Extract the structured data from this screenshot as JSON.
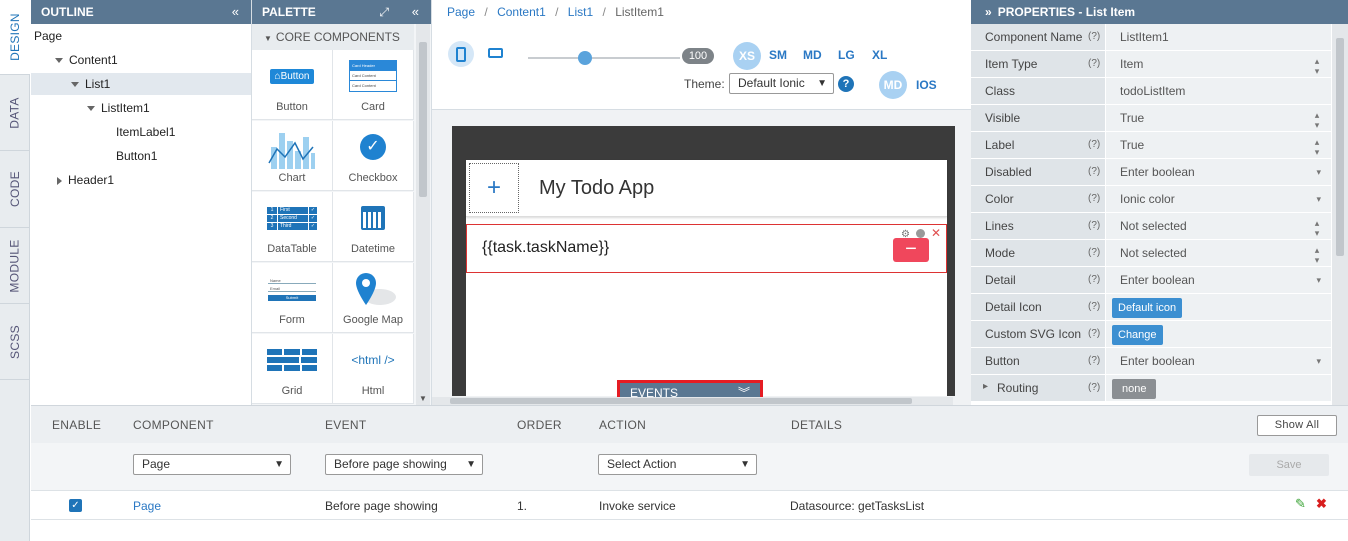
{
  "vertical_tabs": [
    {
      "label": "DESIGN",
      "active": true
    },
    {
      "label": "DATA",
      "active": false
    },
    {
      "label": "CODE",
      "active": false
    },
    {
      "label": "MODULE",
      "active": false
    },
    {
      "label": "SCSS",
      "active": false
    }
  ],
  "outline": {
    "title": "OUTLINE",
    "collapse_icon": "double-chevron-left-icon",
    "items": [
      "Page",
      "Content1",
      "List1",
      "ListItem1",
      "ItemLabel1",
      "Button1",
      "Header1"
    ]
  },
  "palette": {
    "title": "PALETTE",
    "section": "CORE COMPONENTS",
    "items": [
      "Button",
      "Card",
      "Chart",
      "Checkbox",
      "DataTable",
      "Datetime",
      "Form",
      "Google Map",
      "Grid",
      "Html"
    ],
    "button_icon_text": "Button",
    "html_icon_text": "<html />",
    "card_rows": [
      "Card Header",
      "Card Content",
      "Card Content"
    ],
    "table_rows": [
      [
        "1",
        "First"
      ],
      [
        "2",
        "Second"
      ],
      [
        "3",
        "Third"
      ]
    ],
    "form_labels": [
      "Name",
      "Email",
      "Submit"
    ]
  },
  "canvas": {
    "breadcrumb": [
      "Page",
      "Content1",
      "List1",
      "ListItem1"
    ],
    "slider_value": "100",
    "sizes": [
      "XS",
      "SM",
      "MD",
      "LG",
      "XL"
    ],
    "theme_label": "Theme:",
    "theme_value": "Default Ionic",
    "platforms": [
      "MD",
      "IOS"
    ],
    "app_title": "My Todo App",
    "item_label": "{{task.taskName}}",
    "events_label": "EVENTS"
  },
  "properties": {
    "title": "PROPERTIES - List Item",
    "help": "(?)",
    "rows": [
      {
        "key": "Component Name",
        "help": true,
        "value": "ListItem1",
        "type": "text"
      },
      {
        "key": "Item Type",
        "help": true,
        "value": "Item",
        "type": "spin"
      },
      {
        "key": "Class",
        "help": false,
        "value": "todoListItem",
        "type": "text"
      },
      {
        "key": "Visible",
        "help": false,
        "value": "True",
        "type": "spin"
      },
      {
        "key": "Label",
        "help": true,
        "value": "True",
        "type": "spin"
      },
      {
        "key": "Disabled",
        "help": true,
        "value": "Enter boolean",
        "type": "drop"
      },
      {
        "key": "Color",
        "help": true,
        "value": "Ionic color",
        "type": "drop"
      },
      {
        "key": "Lines",
        "help": true,
        "value": "Not selected",
        "type": "spin"
      },
      {
        "key": "Mode",
        "help": true,
        "value": "Not selected",
        "type": "spin"
      },
      {
        "key": "Detail",
        "help": true,
        "value": "Enter boolean",
        "type": "drop"
      },
      {
        "key": "Detail Icon",
        "help": true,
        "value": "Default icon",
        "type": "button"
      },
      {
        "key": "Custom SVG Icon",
        "help": true,
        "value": "Change",
        "type": "button"
      },
      {
        "key": "Button",
        "help": true,
        "value": "Enter boolean",
        "type": "drop"
      },
      {
        "key": "Routing",
        "help": true,
        "value": "none",
        "type": "gray"
      }
    ]
  },
  "events": {
    "columns": [
      "ENABLE",
      "COMPONENT",
      "EVENT",
      "ORDER",
      "ACTION",
      "DETAILS"
    ],
    "show_all": "Show All",
    "save": "Save",
    "filters": {
      "component": "Page",
      "event": "Before page showing",
      "action": "Select Action"
    },
    "rows": [
      {
        "enabled": true,
        "component": "Page",
        "event": "Before page showing",
        "order": "1.",
        "action": "Invoke service",
        "details": "Datasource: getTasksList"
      }
    ]
  },
  "colors": {
    "header": "#5a7792",
    "accent": "#2a78c4",
    "highlight": "#e51c23"
  }
}
